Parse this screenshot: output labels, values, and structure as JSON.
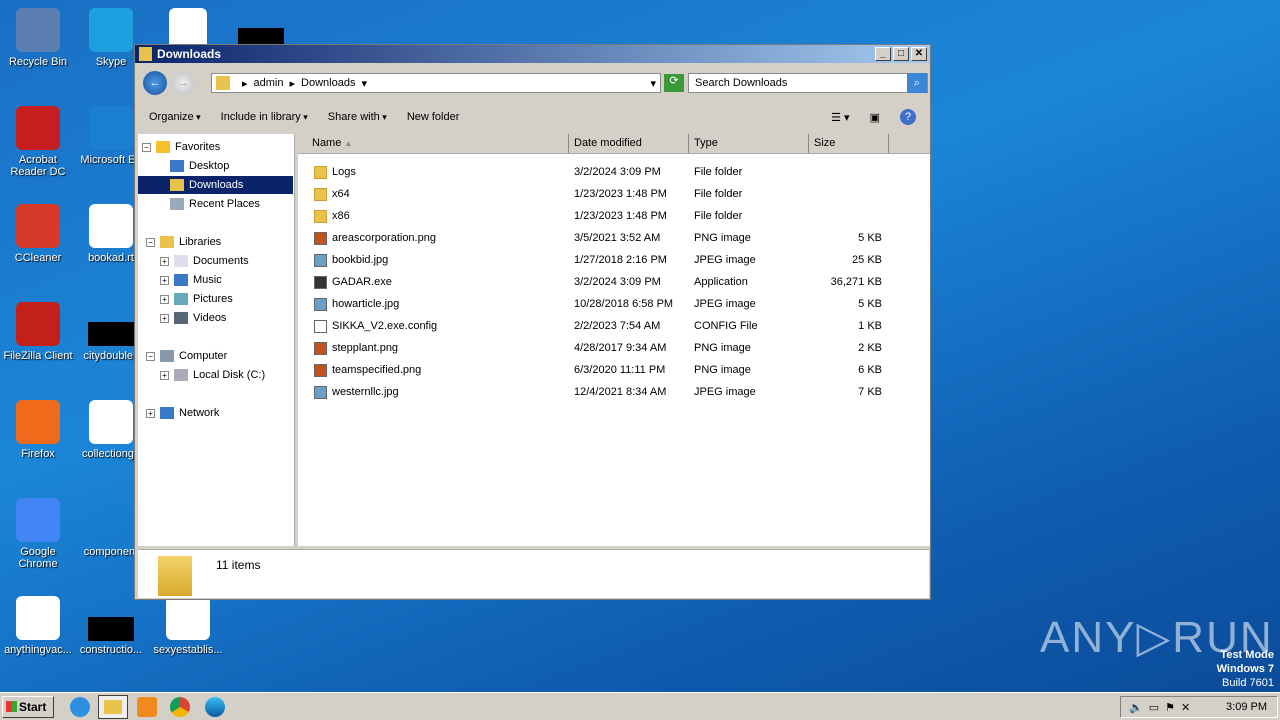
{
  "desktop": {
    "icons": [
      "Recycle Bin",
      "Skype",
      "Acrobat Reader DC",
      "Microsoft Ed",
      "CCleaner",
      "bookad.rt",
      "FileZilla Client",
      "citydouble.j",
      "Firefox",
      "collectionga",
      "Google Chrome",
      "component",
      "anythingvac...",
      "constructio...",
      "sexyestablis..."
    ]
  },
  "window": {
    "title": "Downloads",
    "breadcrumb": [
      "admin",
      "Downloads"
    ],
    "search_placeholder": "Search Downloads",
    "toolbar": {
      "organize": "Organize",
      "include": "Include in library",
      "share": "Share with",
      "new_folder": "New folder"
    },
    "nav": {
      "favorites": "Favorites",
      "desktop": "Desktop",
      "downloads": "Downloads",
      "recent": "Recent Places",
      "libraries": "Libraries",
      "documents": "Documents",
      "music": "Music",
      "pictures": "Pictures",
      "videos": "Videos",
      "computer": "Computer",
      "local_disk": "Local Disk (C:)",
      "network": "Network"
    },
    "columns": {
      "name": "Name",
      "date": "Date modified",
      "type": "Type",
      "size": "Size"
    },
    "files": [
      {
        "name": "Logs",
        "date": "3/2/2024 3:09 PM",
        "type": "File folder",
        "size": "",
        "kind": "folder"
      },
      {
        "name": "x64",
        "date": "1/23/2023 1:48 PM",
        "type": "File folder",
        "size": "",
        "kind": "folder"
      },
      {
        "name": "x86",
        "date": "1/23/2023 1:48 PM",
        "type": "File folder",
        "size": "",
        "kind": "folder"
      },
      {
        "name": "areascorporation.png",
        "date": "3/5/2021 3:52 AM",
        "type": "PNG image",
        "size": "5 KB",
        "kind": "png"
      },
      {
        "name": "bookbid.jpg",
        "date": "1/27/2018 2:16 PM",
        "type": "JPEG image",
        "size": "25 KB",
        "kind": "jpg"
      },
      {
        "name": "GADAR.exe",
        "date": "3/2/2024 3:09 PM",
        "type": "Application",
        "size": "36,271 KB",
        "kind": "exe"
      },
      {
        "name": "howarticle.jpg",
        "date": "10/28/2018 6:58 PM",
        "type": "JPEG image",
        "size": "5 KB",
        "kind": "jpg"
      },
      {
        "name": "SIKKA_V2.exe.config",
        "date": "2/2/2023 7:54 AM",
        "type": "CONFIG File",
        "size": "1 KB",
        "kind": "cfg"
      },
      {
        "name": "stepplant.png",
        "date": "4/28/2017 9:34 AM",
        "type": "PNG image",
        "size": "2 KB",
        "kind": "png"
      },
      {
        "name": "teamspecified.png",
        "date": "6/3/2020 11:11 PM",
        "type": "PNG image",
        "size": "6 KB",
        "kind": "png"
      },
      {
        "name": "westernllc.jpg",
        "date": "12/4/2021 8:34 AM",
        "type": "JPEG image",
        "size": "7 KB",
        "kind": "jpg"
      }
    ],
    "status": "11 items"
  },
  "taskbar": {
    "start": "Start",
    "clock": "3:09 PM"
  },
  "watermark": {
    "line1": "Test Mode",
    "line2": "Windows 7",
    "line3": "Build 7601",
    "logo": "ANY RUN"
  }
}
